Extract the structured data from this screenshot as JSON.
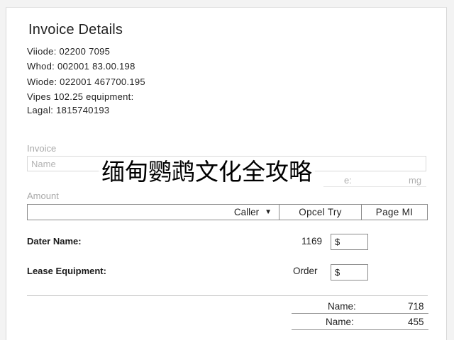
{
  "header": {
    "title": "Invoice Details",
    "lines": [
      "Viiode: 02200 7095",
      "Whod: 002001 83.00.198",
      "Wiode: 022001 467700.195",
      "Vipes 102.25 equipment:",
      "Lagal: 1815740193"
    ]
  },
  "invoice_section": {
    "label": "Invoice",
    "name_placeholder": "Name",
    "overlay_text": "缅甸鹦鹉文化全攻略",
    "faint_suffix": "e:",
    "faint_unit": "mg"
  },
  "amount_section": {
    "label": "Amount",
    "caller_label": "Caller",
    "caret": "▼",
    "opcel_button": "Opcel Try",
    "page_button": "Page MI"
  },
  "rows": [
    {
      "label": "Dater Name:",
      "value": "1169",
      "currency": "$"
    },
    {
      "label": "Lease Equipment:",
      "value": "Order",
      "currency": "$"
    }
  ],
  "summary": [
    {
      "label": "Name:",
      "value": "718"
    },
    {
      "label": "Name:",
      "value": "455"
    }
  ]
}
